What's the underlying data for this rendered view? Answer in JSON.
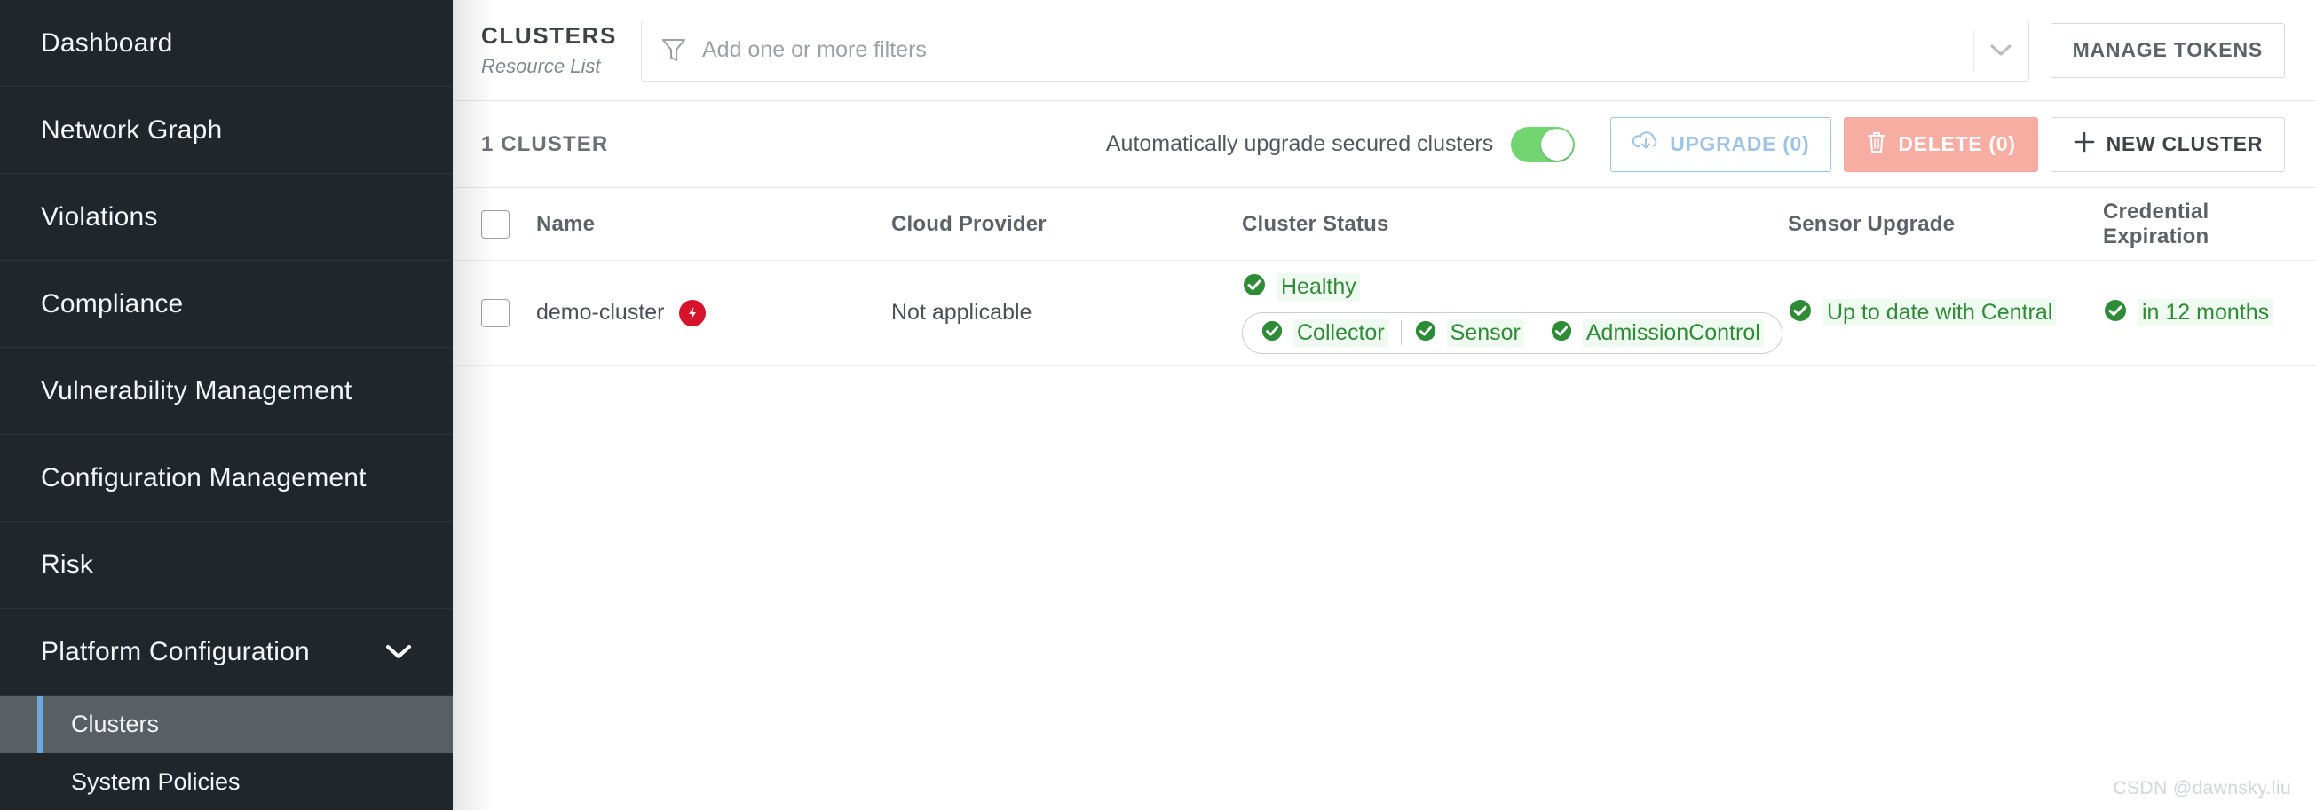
{
  "sidebar": {
    "items": [
      {
        "label": "Dashboard",
        "name": "dashboard",
        "expandable": false
      },
      {
        "label": "Network Graph",
        "name": "network-graph",
        "expandable": false
      },
      {
        "label": "Violations",
        "name": "violations",
        "expandable": false
      },
      {
        "label": "Compliance",
        "name": "compliance",
        "expandable": false
      },
      {
        "label": "Vulnerability Management",
        "name": "vulnerability-management",
        "expandable": false
      },
      {
        "label": "Configuration Management",
        "name": "configuration-management",
        "expandable": false
      },
      {
        "label": "Risk",
        "name": "risk",
        "expandable": false
      },
      {
        "label": "Platform Configuration",
        "name": "platform-configuration",
        "expandable": true
      }
    ],
    "sub_items": [
      {
        "label": "Clusters",
        "name": "clusters",
        "active": true
      },
      {
        "label": "System Policies",
        "name": "system-policies",
        "active": false
      }
    ],
    "active_accent_color": "#6ca8e0",
    "background_color": "#21262b"
  },
  "header": {
    "title": "CLUSTERS",
    "subtitle": "Resource List",
    "filter_placeholder": "Add one or more filters",
    "filter_value": "",
    "manage_tokens_label": "MANAGE TOKENS"
  },
  "toolbar": {
    "count_label": "1 CLUSTER",
    "auto_upgrade_label": "Automatically upgrade secured clusters",
    "auto_upgrade_on": true,
    "toggle_on_color": "#72d572",
    "upgrade_label": "UPGRADE (0)",
    "delete_label": "DELETE (0)",
    "new_cluster_label": "NEW CLUSTER",
    "delete_bg_color": "#f8ada3",
    "upgrade_border_color": "#9dc3e6"
  },
  "table": {
    "columns": [
      {
        "label": "Name",
        "name": "name"
      },
      {
        "label": "Cloud Provider",
        "name": "cloud-provider"
      },
      {
        "label": "Cluster Status",
        "name": "cluster-status"
      },
      {
        "label": "Sensor Upgrade",
        "name": "sensor-upgrade"
      },
      {
        "label": "Credential Expiration",
        "name": "credential-expiration"
      }
    ],
    "rows": [
      {
        "name": "demo-cluster",
        "name_badge": "bolt-badge",
        "name_badge_color": "#d6132a",
        "cloud_provider": "Not applicable",
        "cluster_status": "Healthy",
        "components": [
          "Collector",
          "Sensor",
          "AdmissionControl"
        ],
        "sensor_upgrade": "Up to date with Central",
        "credential_expiration": "in 12 months",
        "status_color": "#2e8b36",
        "selected": false
      }
    ]
  },
  "watermark": "CSDN @dawnsky.liu"
}
